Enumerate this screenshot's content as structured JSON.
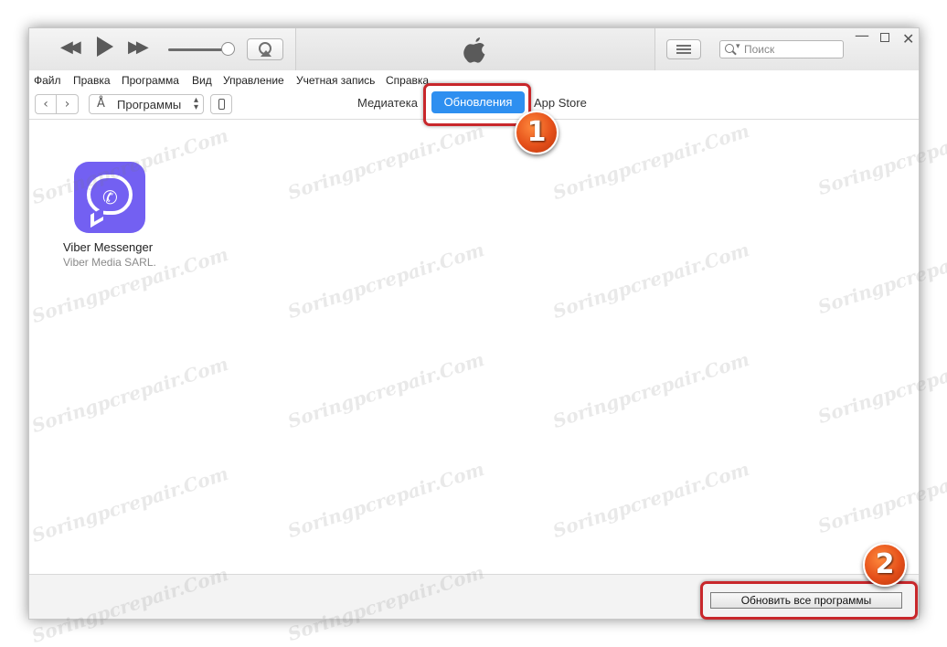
{
  "window": {
    "search_placeholder": "Поиск"
  },
  "menu": [
    "Файл",
    "Правка",
    "Программа",
    "Вид",
    "Управление",
    "Учетная запись",
    "Справка"
  ],
  "nav": {
    "media_label": "Программы",
    "tabs": {
      "library": "Медиатека",
      "updates": "Обновления",
      "store": "App Store"
    }
  },
  "apps": [
    {
      "name": "Viber Messenger",
      "vendor": "Viber Media SARL."
    }
  ],
  "bottom": {
    "update_all_label": "Обновить все программы"
  },
  "annotations": {
    "step1": "1",
    "step2": "2"
  },
  "watermark": "Soringpcrepair.Com",
  "colors": {
    "accent": "#2e8ff0",
    "highlight": "#c8272b",
    "viber": "#7360f2",
    "badge": "#e5501a"
  }
}
